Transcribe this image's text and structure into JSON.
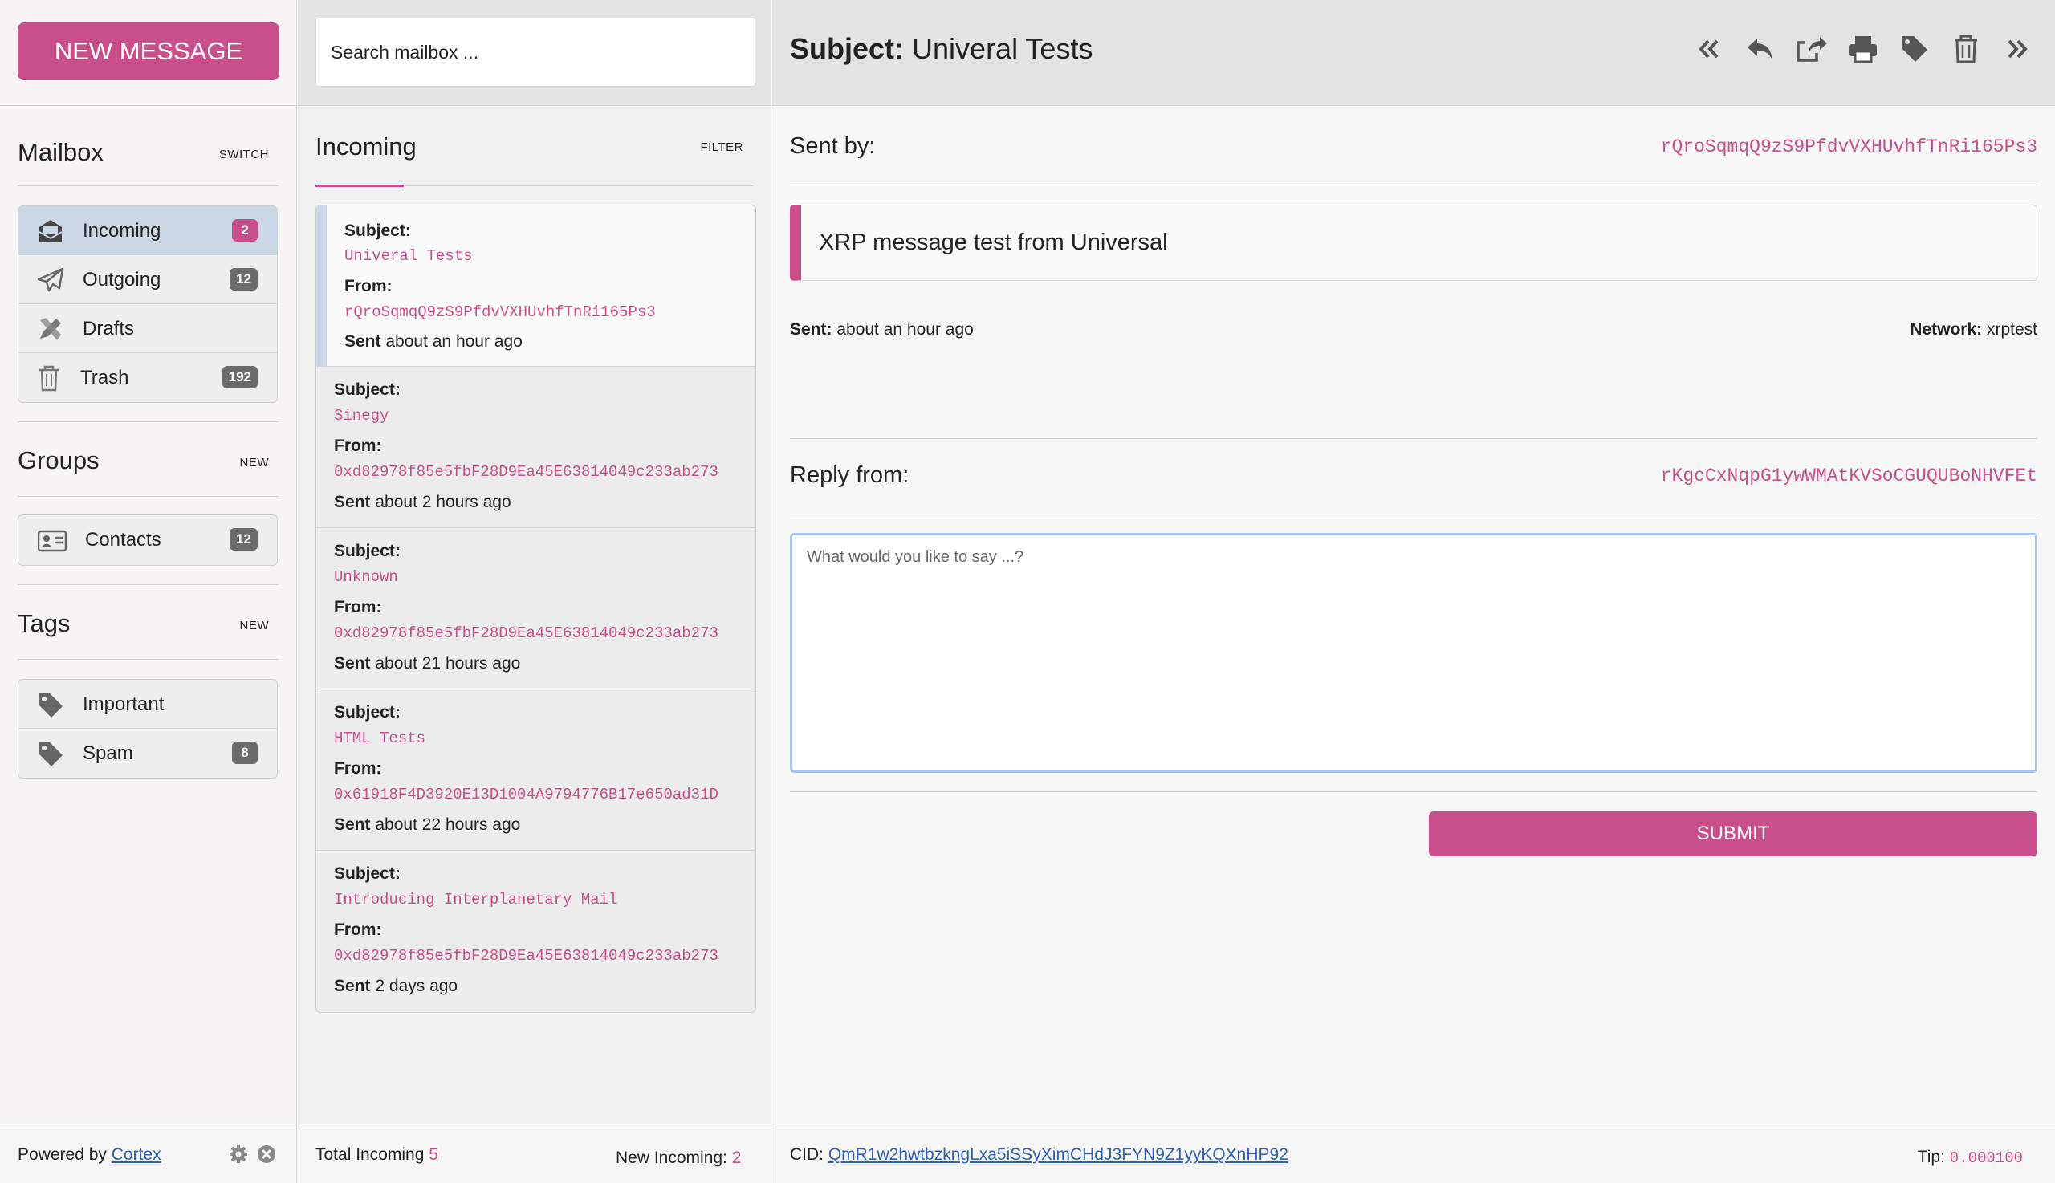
{
  "col1": {
    "new_message": "NEW MESSAGE",
    "mailbox": {
      "title": "Mailbox",
      "action": "SWITCH",
      "items": [
        {
          "label": "Incoming",
          "count": "2",
          "icon": "inbox-icon",
          "active": true
        },
        {
          "label": "Outgoing",
          "count": "12",
          "icon": "paper-plane-icon"
        },
        {
          "label": "Drafts",
          "count": "",
          "icon": "pencil-ruler-icon"
        },
        {
          "label": "Trash",
          "count": "192",
          "icon": "trash-icon"
        }
      ]
    },
    "groups": {
      "title": "Groups",
      "action": "NEW",
      "items": [
        {
          "label": "Contacts",
          "count": "12",
          "icon": "address-card-icon"
        }
      ]
    },
    "tags": {
      "title": "Tags",
      "action": "NEW",
      "items": [
        {
          "label": "Important",
          "count": "",
          "icon": "tag-icon"
        },
        {
          "label": "Spam",
          "count": "8",
          "icon": "tag-icon"
        }
      ]
    },
    "footer": {
      "powered_by": "Powered by",
      "link": "Cortex"
    }
  },
  "col2": {
    "search_placeholder": "Search mailbox ...",
    "list_title": "Incoming",
    "list_action": "FILTER",
    "messages": [
      {
        "subject_label": "Subject:",
        "subject": "Univeral Tests",
        "from_label": "From:",
        "from": "rQroSqmqQ9zS9PfdvVXHUvhfTnRi165Ps3",
        "sent_label": "Sent",
        "sent": "about an hour ago"
      },
      {
        "subject_label": "Subject:",
        "subject": "Sinegy",
        "from_label": "From:",
        "from": "0xd82978f85e5fbF28D9Ea45E63814049c233ab273",
        "sent_label": "Sent",
        "sent": "about 2 hours ago"
      },
      {
        "subject_label": "Subject:",
        "subject": "Unknown",
        "from_label": "From:",
        "from": "0xd82978f85e5fbF28D9Ea45E63814049c233ab273",
        "sent_label": "Sent",
        "sent": "about 21 hours ago"
      },
      {
        "subject_label": "Subject:",
        "subject": "HTML Tests",
        "from_label": "From:",
        "from": "0x61918F4D3920E13D1004A9794776B17e650ad31D",
        "sent_label": "Sent",
        "sent": "about 22 hours ago"
      },
      {
        "subject_label": "Subject:",
        "subject": "Introducing Interplanetary Mail",
        "from_label": "From:",
        "from": "0xd82978f85e5fbF28D9Ea45E63814049c233ab273",
        "sent_label": "Sent",
        "sent": "2 days ago"
      }
    ],
    "footer": {
      "total_label": "Total Incoming",
      "total": "5",
      "new_label": "New Incoming:",
      "new": "2"
    }
  },
  "col3": {
    "subject_label": "Subject:",
    "subject": "Univeral Tests",
    "toolbar": [
      "double-left-icon",
      "reply-icon",
      "share-icon",
      "print-icon",
      "tag-icon",
      "trash-icon",
      "double-right-icon"
    ],
    "sent_by_label": "Sent by:",
    "sent_by": "rQroSqmqQ9zS9PfdvVXHUvhfTnRi165Ps3",
    "body": "XRP message test from Universal",
    "sent_label": "Sent:",
    "sent": "about an hour ago",
    "network_label": "Network:",
    "network": "xrptest",
    "reply_from_label": "Reply from:",
    "reply_from": "rKgcCxNqpG1ywWMAtKVSoCGUQUBoNHVFEt",
    "reply_placeholder": "What would you like to say ...?",
    "submit": "SUBMIT",
    "footer": {
      "cid_label": "CID:",
      "cid": "QmR1w2hwtbzkngLxa5iSSyXimCHdJ3FYN9Z1yyKQXnHP92",
      "tip_label": "Tip:",
      "tip": "0.000100"
    }
  },
  "colors": {
    "accent": "#c94f8b",
    "active_bg": "#ccd7e6",
    "link": "#2f5fb6"
  }
}
